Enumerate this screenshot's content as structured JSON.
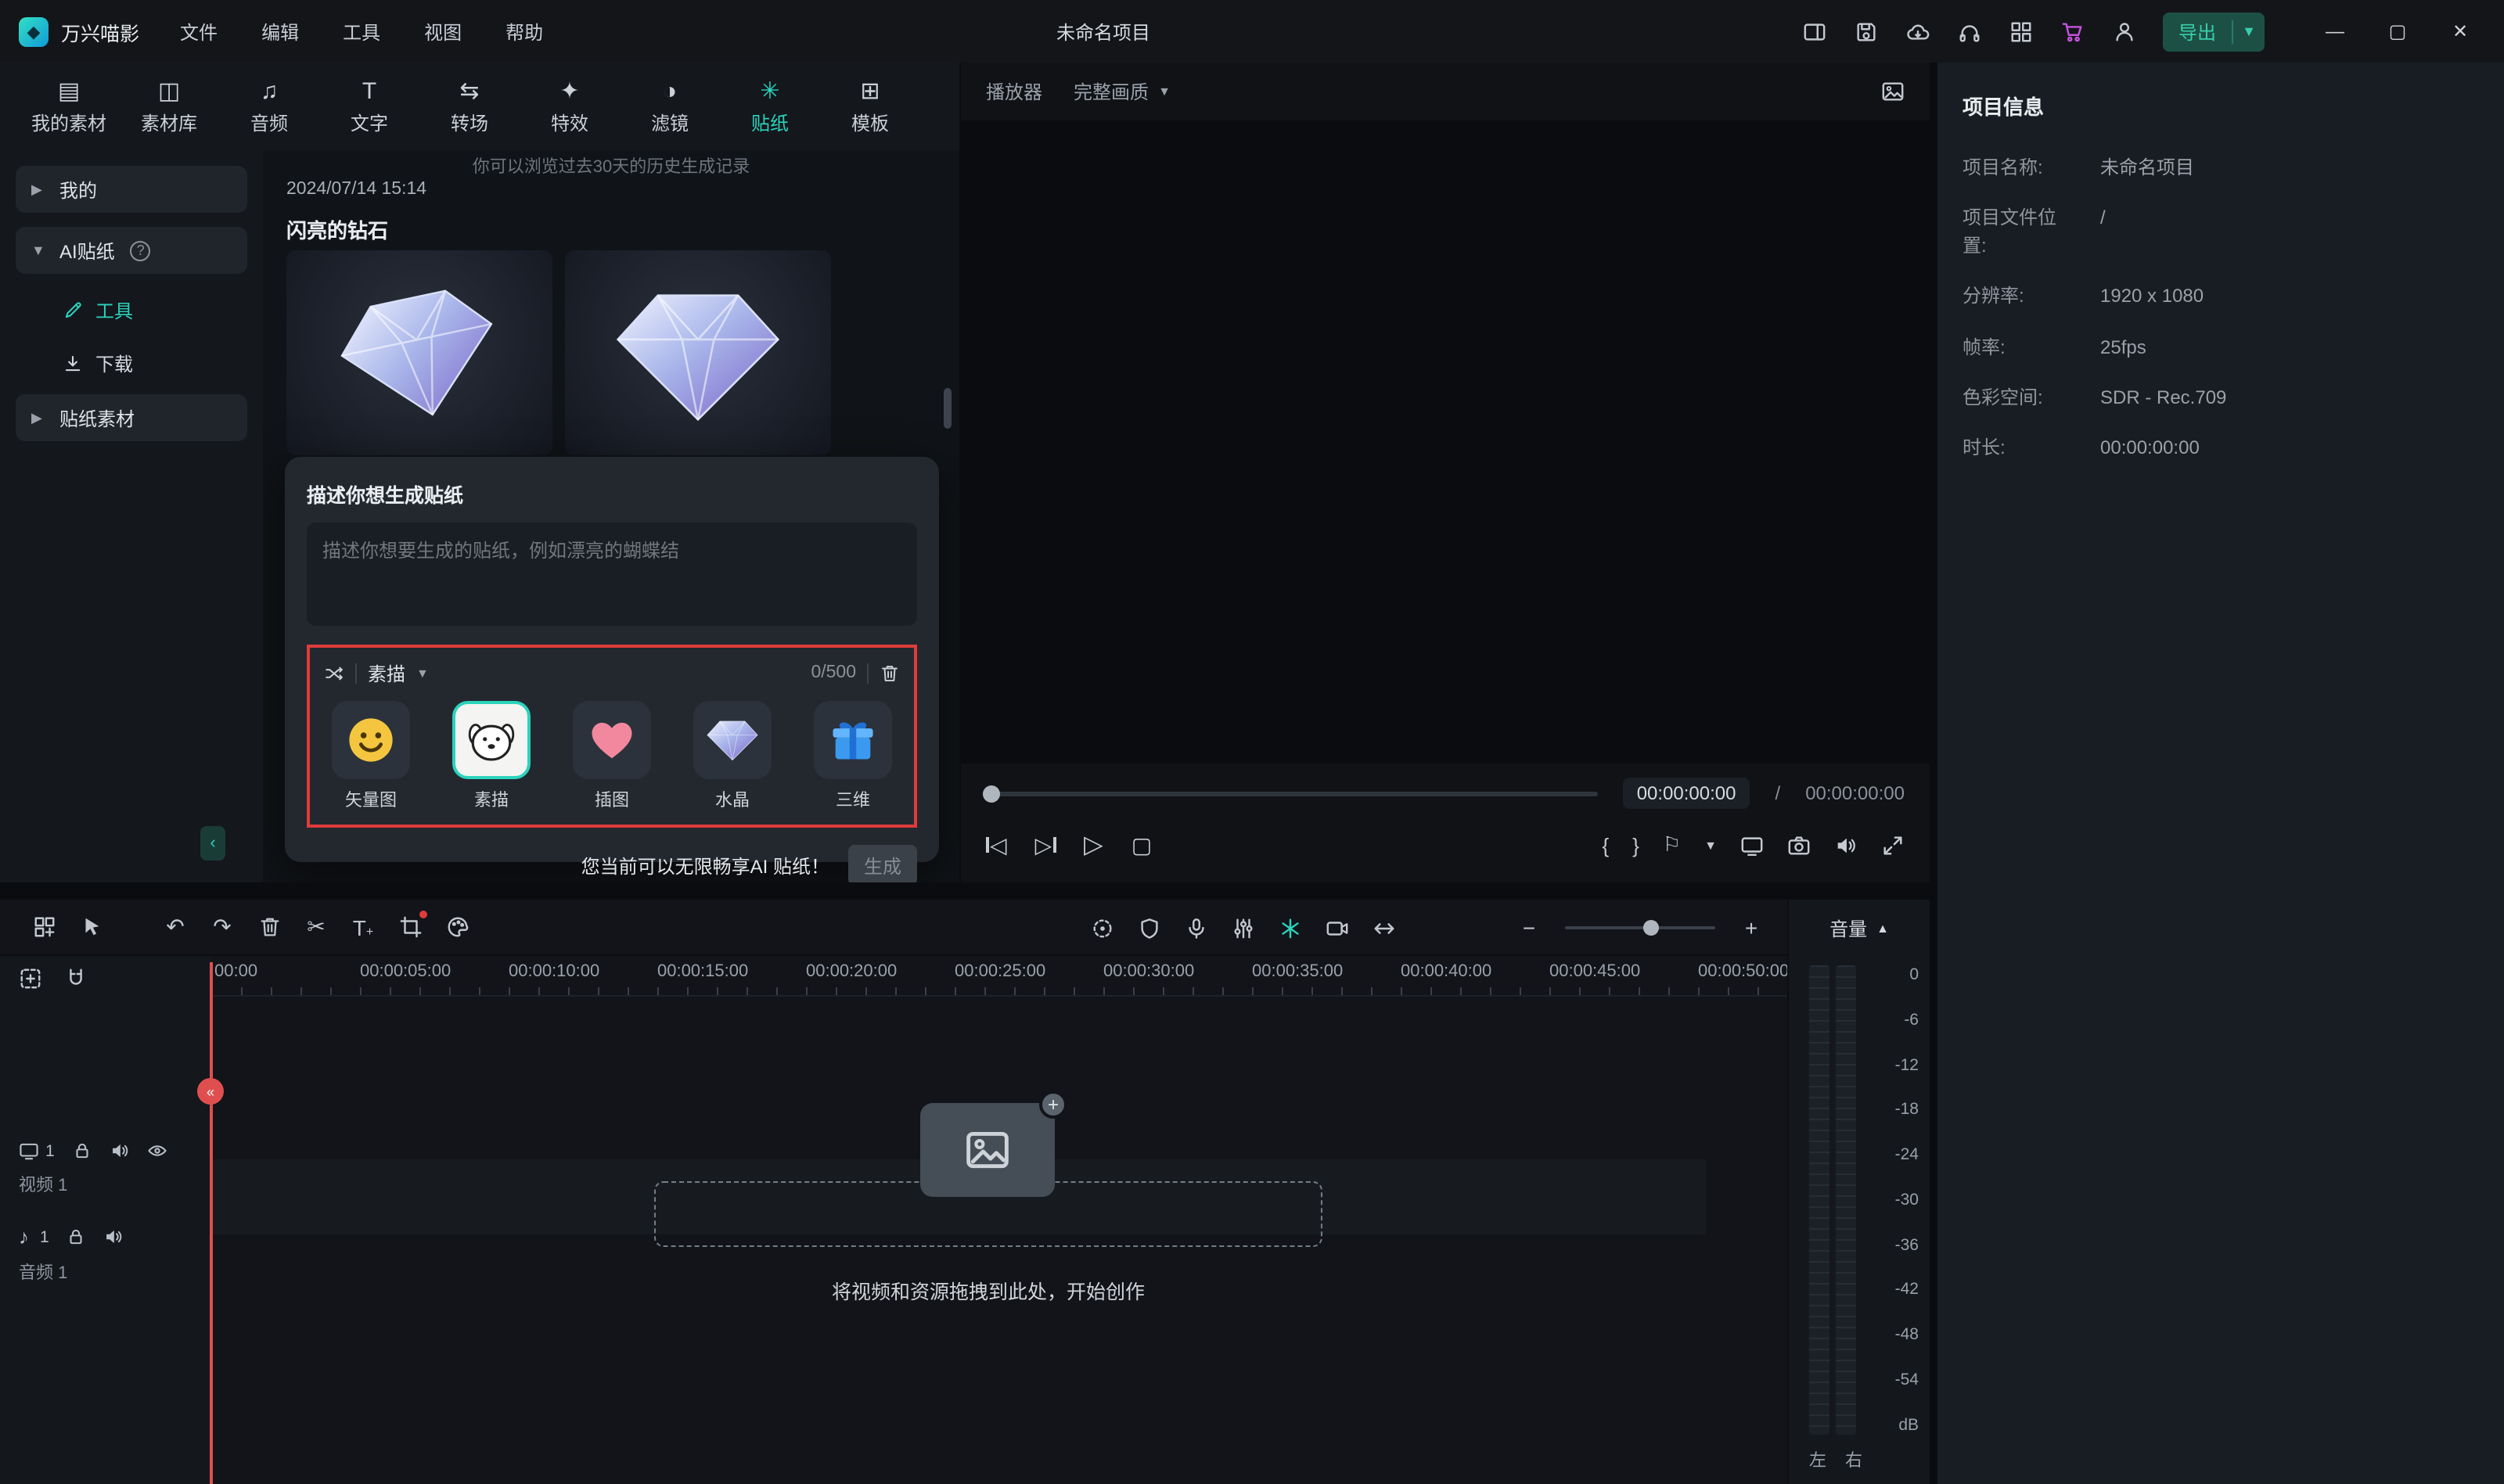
{
  "titlebar": {
    "app_name": "万兴喵影",
    "menus": [
      "文件",
      "编辑",
      "工具",
      "视图",
      "帮助"
    ],
    "project_title": "未命名项目",
    "export_label": "导出"
  },
  "media_tabs": [
    "我的素材",
    "素材库",
    "音频",
    "文字",
    "转场",
    "特效",
    "滤镜",
    "贴纸",
    "模板"
  ],
  "sidebar": {
    "my": "我的",
    "ai_sticker": "AI贴纸",
    "tools": "工具",
    "download": "下载",
    "sticker_assets": "贴纸素材"
  },
  "history": {
    "hint": "你可以浏览过去30天的历史生成记录",
    "timestamp": "2024/07/14 15:14",
    "title": "闪亮的钻石"
  },
  "generator": {
    "title": "描述你想生成贴纸",
    "placeholder": "描述你想要生成的贴纸，例如漂亮的蝴蝶结",
    "style_dropdown": "素描",
    "char_counter": "0/500",
    "styles": [
      "矢量图",
      "素描",
      "插图",
      "水晶",
      "三维"
    ],
    "promo": "您当前可以无限畅享AI 贴纸！",
    "generate": "生成"
  },
  "player": {
    "label": "播放器",
    "quality": "完整画质",
    "current_time": "00:00:00:00",
    "separator": "/",
    "duration": "00:00:00:00"
  },
  "project_info": {
    "title": "项目信息",
    "fields": [
      {
        "label": "项目名称:",
        "value": "未命名项目"
      },
      {
        "label": "项目文件位置:",
        "value": "/"
      },
      {
        "label": "分辨率:",
        "value": "1920 x 1080"
      },
      {
        "label": "帧率:",
        "value": "25fps"
      },
      {
        "label": "色彩空间:",
        "value": "SDR - Rec.709"
      },
      {
        "label": "时长:",
        "value": "00:00:00:00"
      }
    ]
  },
  "timeline": {
    "ruler": [
      "00:00",
      "00:00:05:00",
      "00:00:10:00",
      "00:00:15:00",
      "00:00:20:00",
      "00:00:25:00",
      "00:00:30:00",
      "00:00:35:00",
      "00:00:40:00",
      "00:00:45:00",
      "00:00:50:00"
    ],
    "video_track": "视频 1",
    "video_num": "1",
    "audio_track": "音频 1",
    "audio_num": "1",
    "dropzone": "将视频和资源拖拽到此处，开始创作"
  },
  "volume": {
    "label": "音量",
    "scale": [
      "0",
      "-6",
      "-12",
      "-18",
      "-24",
      "-30",
      "-36",
      "-42",
      "-48",
      "-54",
      "dB"
    ],
    "left": "左",
    "right": "右"
  }
}
